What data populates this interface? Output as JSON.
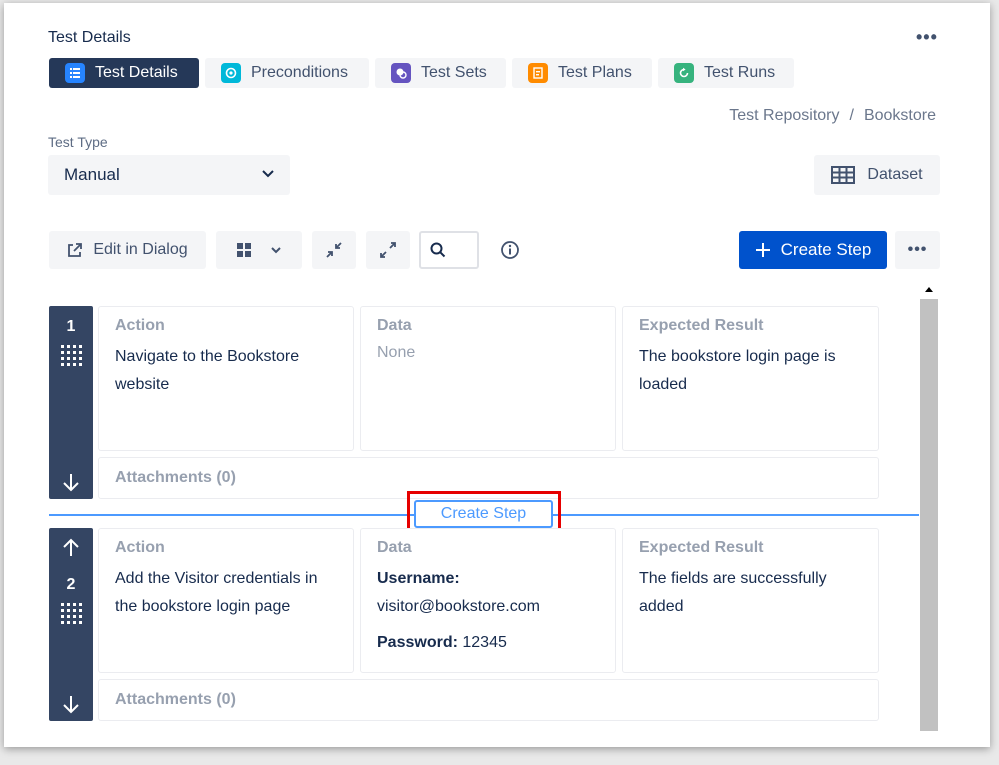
{
  "header": {
    "title": "Test Details",
    "more_icon": "more-horizontal-icon"
  },
  "tabs": [
    {
      "label": "Test Details",
      "icon": "list-icon",
      "color": "#2684ff",
      "active": true
    },
    {
      "label": "Preconditions",
      "icon": "precondition-icon",
      "color": "#00b8d9",
      "active": false
    },
    {
      "label": "Test Sets",
      "icon": "test-sets-icon",
      "color": "#6554c0",
      "active": false
    },
    {
      "label": "Test Plans",
      "icon": "test-plans-icon",
      "color": "#ff8b00",
      "active": false
    },
    {
      "label": "Test Runs",
      "icon": "test-runs-icon",
      "color": "#36b37e",
      "active": false
    }
  ],
  "breadcrumb": {
    "root": "Test Repository",
    "separator": "/",
    "current": "Bookstore"
  },
  "test_type": {
    "label": "Test Type",
    "value": "Manual"
  },
  "dataset_button": {
    "label": "Dataset"
  },
  "toolbar": {
    "edit_dialog_label": "Edit in Dialog",
    "create_step_label": "Create Step"
  },
  "steps": [
    {
      "number": "1",
      "action_header": "Action",
      "action": "Navigate to the Bookstore website",
      "data_header": "Data",
      "data": "None",
      "expected_header": "Expected Result",
      "expected": "The bookstore login page is loaded",
      "attachments": "Attachments (0)"
    },
    {
      "number": "2",
      "action_header": "Action",
      "action": "Add the Visitor credentials in the bookstore login page",
      "data_header": "Data",
      "data_username_label": "Username:",
      "data_username_value": "visitor@bookstore.com",
      "data_password_label": "Password:",
      "data_password_value": "12345",
      "expected_header": "Expected Result",
      "expected": "The fields are successfully added",
      "attachments": "Attachments (0)"
    }
  ],
  "inline_create_step": {
    "label": "Create Step"
  },
  "colors": {
    "primary": "#0052cc",
    "active_tab": "#253858",
    "gutter": "#344563",
    "insert_line": "#4c9aff",
    "highlight": "#e60000"
  }
}
